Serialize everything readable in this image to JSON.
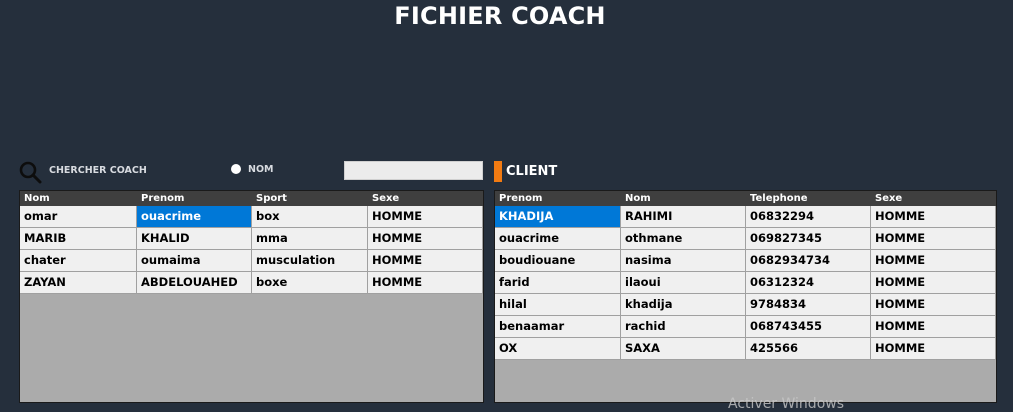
{
  "window": {
    "title": "FICHIER COACH"
  },
  "search": {
    "label": "CHERCHER COACH",
    "radio_label": "NOM",
    "input_value": ""
  },
  "client_section": {
    "label": "CLIENT",
    "accent_color": "#f27b12"
  },
  "coach_table": {
    "columns": [
      "Nom",
      "Prenom",
      "Sport",
      "Sexe"
    ],
    "rows": [
      [
        "omar",
        "ouacrime",
        "box",
        "HOMME"
      ],
      [
        "MARIB",
        "KHALID",
        "mma",
        "HOMME"
      ],
      [
        "chater",
        "oumaima",
        "musculation",
        "HOMME"
      ],
      [
        "ZAYAN",
        "ABDELOUAHED",
        "boxe",
        "HOMME"
      ]
    ]
  },
  "client_table": {
    "columns": [
      "Prenom",
      "Nom",
      "Telephone",
      "Sexe"
    ],
    "rows": [
      [
        "KHADIJA",
        "RAHIMI",
        "06832294",
        "HOMME"
      ],
      [
        "ouacrime",
        "othmane",
        "069827345",
        "HOMME"
      ],
      [
        "boudiouane",
        "nasima",
        "0682934734",
        "HOMME"
      ],
      [
        "farid",
        "ilaoui",
        "06312324",
        "HOMME"
      ],
      [
        "hilal",
        "khadija",
        "9784834",
        "HOMME"
      ],
      [
        "benaamar",
        "rachid",
        "068743455",
        "HOMME"
      ],
      [
        "OX",
        "SAXA",
        "425566",
        "HOMME"
      ]
    ]
  },
  "watermark": "Activer Windows",
  "colors": {
    "background": "#252f3c",
    "selection": "#0078d7",
    "grid_header": "#3f3f3f"
  }
}
